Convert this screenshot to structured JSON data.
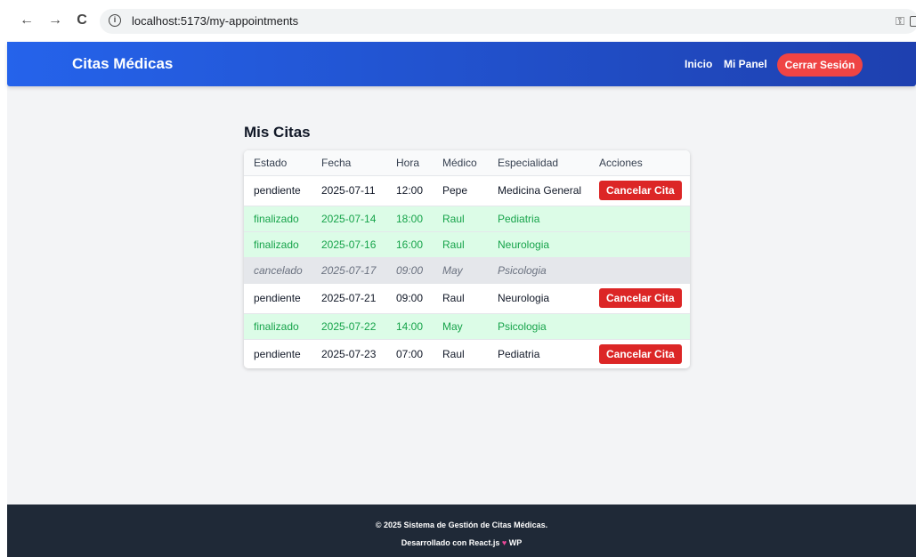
{
  "browser": {
    "url": "localhost:5173/my-appointments",
    "back_glyph": "←",
    "forward_glyph": "→",
    "reload_glyph": "C",
    "info_glyph": "i",
    "key_glyph": "⚿"
  },
  "header": {
    "brand": "Citas Médicas",
    "nav": [
      "Inicio",
      "Mi Panel"
    ],
    "logout_label": "Cerrar Sesión"
  },
  "main": {
    "title": "Mis Citas",
    "columns": [
      "Estado",
      "Fecha",
      "Hora",
      "Médico",
      "Especialidad",
      "Acciones"
    ],
    "cancel_label": "Cancelar Cita",
    "rows": [
      {
        "estado": "pendiente",
        "fecha": "2025-07-11",
        "hora": "12:00",
        "medico": "Pepe",
        "especialidad": "Medicina General",
        "cancelable": true
      },
      {
        "estado": "finalizado",
        "fecha": "2025-07-14",
        "hora": "18:00",
        "medico": "Raul",
        "especialidad": "Pediatria",
        "cancelable": false
      },
      {
        "estado": "finalizado",
        "fecha": "2025-07-16",
        "hora": "16:00",
        "medico": "Raul",
        "especialidad": "Neurologia",
        "cancelable": false
      },
      {
        "estado": "cancelado",
        "fecha": "2025-07-17",
        "hora": "09:00",
        "medico": "May",
        "especialidad": "Psicologia",
        "cancelable": false
      },
      {
        "estado": "pendiente",
        "fecha": "2025-07-21",
        "hora": "09:00",
        "medico": "Raul",
        "especialidad": "Neurologia",
        "cancelable": true
      },
      {
        "estado": "finalizado",
        "fecha": "2025-07-22",
        "hora": "14:00",
        "medico": "May",
        "especialidad": "Psicologia",
        "cancelable": false
      },
      {
        "estado": "pendiente",
        "fecha": "2025-07-23",
        "hora": "07:00",
        "medico": "Raul",
        "especialidad": "Pediatria",
        "cancelable": true
      }
    ]
  },
  "footer": {
    "line1": "© 2025 Sistema de Gestión de Citas Médicas.",
    "line2_prefix": "Desarrollado con React.js",
    "heart_glyph": "♥",
    "line2_suffix": "WP"
  },
  "colors": {
    "header_start": "#2563eb",
    "header_end": "#1e40af",
    "logout": "#ef4444",
    "cancel": "#dc2626",
    "finalizado_bg": "#dcfce7",
    "finalizado_text": "#16a34a",
    "cancelado_bg": "#e5e7eb",
    "footer_bg": "#1f2937"
  }
}
